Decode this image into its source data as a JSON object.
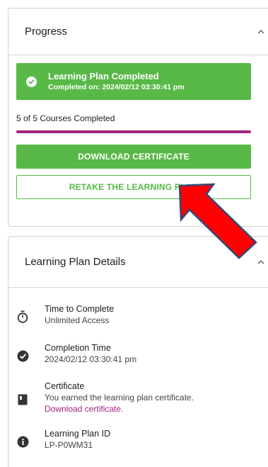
{
  "progress_card": {
    "title": "Progress",
    "banner": {
      "title": "Learning Plan Completed",
      "subtitle": "Completed on: 2024/02/12 03:30:41 pm"
    },
    "courses_completed_text": "5 of 5 Courses Completed",
    "progress_fraction": 1.0,
    "download_button_label": "DOWNLOAD CERTIFICATE",
    "retake_button_label": "RETAKE THE LEARNING PLAN"
  },
  "details_card": {
    "title": "Learning Plan Details",
    "items": [
      {
        "icon": "stopwatch-icon",
        "label": "Time to Complete",
        "value": "Unlimited Access"
      },
      {
        "icon": "check-circle-icon",
        "label": "Completion Time",
        "value": "2024/02/12 03:30:41 pm"
      },
      {
        "icon": "certificate-icon",
        "label": "Certificate",
        "value": "You earned the learning plan certificate.",
        "link": "Download certificate."
      },
      {
        "icon": "info-icon",
        "label": "Learning Plan ID",
        "value": "LP-P0WM31"
      }
    ]
  },
  "colors": {
    "accent_green": "#58b947",
    "accent_magenta": "#a4247e",
    "annotation_red": "#ff0000"
  }
}
